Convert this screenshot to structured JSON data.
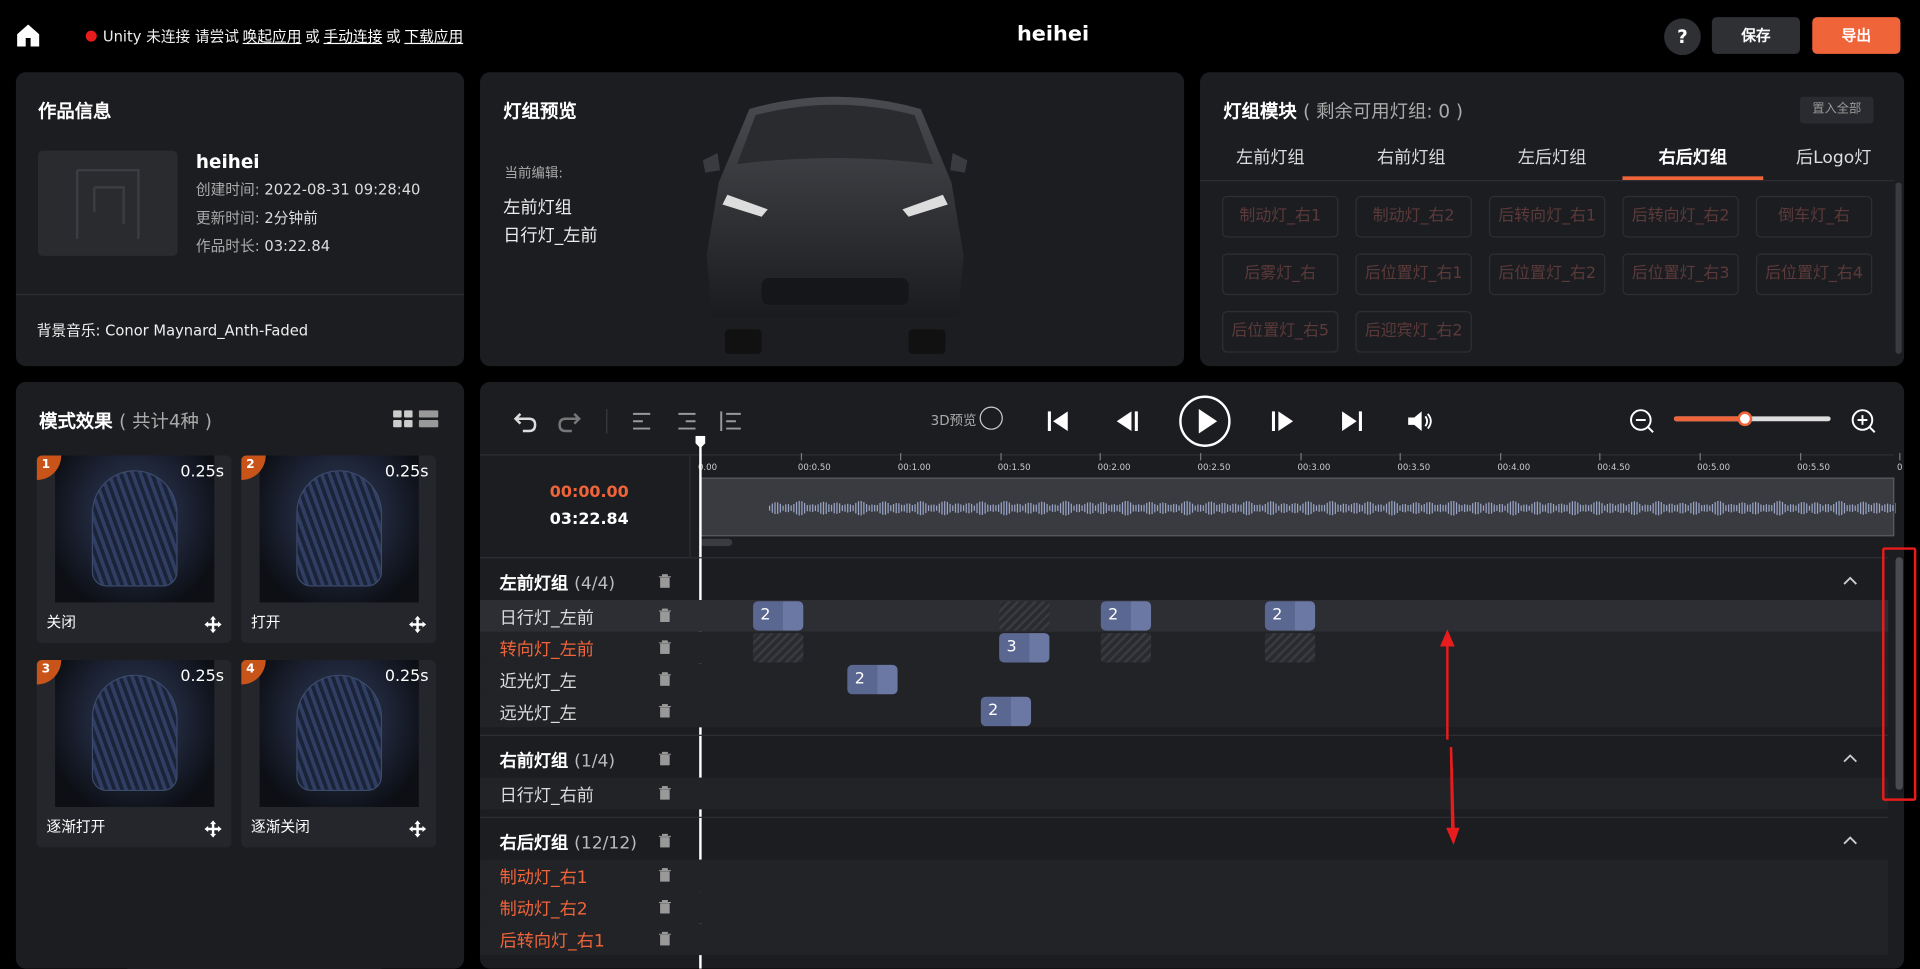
{
  "header": {
    "unity_status_text": "Unity 未连接 请尝试",
    "link_launch": "唤起应用",
    "or1": "或",
    "link_manual": "手动连接",
    "or2": "或",
    "link_download": "下载应用",
    "project_title": "heihei",
    "help_label": "?",
    "save_label": "保存",
    "export_label": "导出"
  },
  "work_info": {
    "title": "作品信息",
    "name": "heihei",
    "created_key": "创建时间:",
    "created_val": "2022-08-31 09:28:40",
    "updated_key": "更新时间:",
    "updated_val": "2分钟前",
    "duration_key": "作品时长:",
    "duration_val": "03:22.84",
    "bgm": "背景音乐:  Conor Maynard_Anth-Faded"
  },
  "preview": {
    "title": "灯组预览",
    "current_label": "当前编辑:",
    "current_group": "左前灯组",
    "current_light": "日行灯_左前"
  },
  "modules": {
    "title": "灯组模块",
    "subtitle": "( 剩余可用灯组: 0 )",
    "place_all": "置入全部",
    "tabs": [
      "左前灯组",
      "右前灯组",
      "左后灯组",
      "右后灯组",
      "后Logo灯"
    ],
    "active_tab": 3,
    "chips": [
      "制动灯_右1",
      "制动灯_右2",
      "后转向灯_右1",
      "后转向灯_右2",
      "倒车灯_右",
      "后雾灯_右",
      "后位置灯_右1",
      "后位置灯_右2",
      "后位置灯_右3",
      "后位置灯_右4",
      "后位置灯_右5",
      "后迎宾灯_右2"
    ]
  },
  "effects": {
    "title": "模式效果",
    "subtitle": "( 共计4种 )",
    "items": [
      {
        "index": "1",
        "duration": "0.25s",
        "name": "关闭"
      },
      {
        "index": "2",
        "duration": "0.25s",
        "name": "打开"
      },
      {
        "index": "3",
        "duration": "0.25s",
        "name": "逐渐打开"
      },
      {
        "index": "4",
        "duration": "0.25s",
        "name": "逐渐关闭"
      }
    ]
  },
  "timeline": {
    "preview_3d_label": "3D预览",
    "current_time": "00:00.00",
    "total_time": "03:22.84",
    "zoom_level": 0.45,
    "ruler_labels": [
      "0.00",
      "00:0.50",
      "00:1.00",
      "00:1.50",
      "00:2.00",
      "00:2.50",
      "00:3.00",
      "00:3.50",
      "00:4.00",
      "00:4.50",
      "00:5.00",
      "00:5.50",
      "0"
    ],
    "groups": [
      {
        "name": "左前灯组",
        "count": "(4/4)",
        "rows": [
          {
            "name": "日行灯_左前",
            "highlight": false
          },
          {
            "name": "转向灯_左前",
            "highlight": true
          },
          {
            "name": "近光灯_左",
            "highlight": false
          },
          {
            "name": "远光灯_左",
            "highlight": false
          }
        ]
      },
      {
        "name": "右前灯组",
        "count": "(1/4)",
        "rows": [
          {
            "name": "日行灯_右前",
            "highlight": false
          }
        ]
      },
      {
        "name": "右后灯组",
        "count": "(12/12)",
        "rows": [
          {
            "name": "制动灯_右1",
            "highlight": true
          },
          {
            "name": "制动灯_右2",
            "highlight": true
          },
          {
            "name": "后转向灯_右1",
            "highlight": true
          }
        ]
      }
    ],
    "blocks": [
      {
        "row": "日行灯_左前",
        "label": "2"
      },
      {
        "row": "日行灯_左前",
        "label": "2"
      },
      {
        "row": "日行灯_左前",
        "label": "2"
      },
      {
        "row": "转向灯_左前",
        "label": "3"
      },
      {
        "row": "近光灯_左",
        "label": "2"
      },
      {
        "row": "远光灯_左",
        "label": "2"
      }
    ]
  },
  "colors": {
    "accent": "#f0643a",
    "panel": "#1c1d21",
    "block": "#5a6790",
    "annotation": "#e81c1c"
  }
}
